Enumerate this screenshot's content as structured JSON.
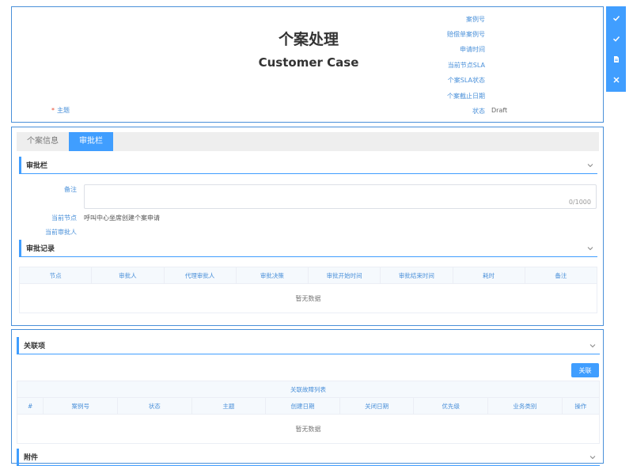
{
  "header": {
    "title_cn": "个案处理",
    "title_en": "Customer Case",
    "subject_label": "主题",
    "required_mark": "*",
    "fields": [
      {
        "label": "案例号",
        "value": ""
      },
      {
        "label": "赔偿单案例号",
        "value": ""
      },
      {
        "label": "申请时间",
        "value": ""
      },
      {
        "label": "当前节点SLA",
        "value": ""
      },
      {
        "label": "个案SLA状态",
        "value": ""
      },
      {
        "label": "个案截止日期",
        "value": ""
      },
      {
        "label": "状态",
        "value": "Draft"
      }
    ]
  },
  "sidebar": {
    "buttons": [
      {
        "name": "check-icon"
      },
      {
        "name": "check-icon"
      },
      {
        "name": "document-icon"
      },
      {
        "name": "close-icon"
      }
    ]
  },
  "tabs": [
    {
      "label": "个案信息",
      "active": false
    },
    {
      "label": "审批栏",
      "active": true
    }
  ],
  "approval": {
    "section_title": "审批栏",
    "remark_label": "备注",
    "remark_value": "",
    "remark_counter": "0/1000",
    "current_node_label": "当前节点",
    "current_node_value": "呼叫中心坐席创建个案申请",
    "current_approver_label": "当前审批人",
    "current_approver_value": ""
  },
  "approval_records": {
    "section_title": "审批记录",
    "columns": [
      "节点",
      "审批人",
      "代理审批人",
      "审批决策",
      "审批开始时间",
      "审批结束时间",
      "耗时",
      "备注"
    ],
    "empty_text": "暂无数据"
  },
  "related": {
    "section_title": "关联项",
    "link_button": "关联",
    "table_caption": "关联故障列表",
    "columns": [
      "#",
      "案例号",
      "状态",
      "主题",
      "创建日期",
      "关闭日期",
      "优先级",
      "业务类别",
      "操作"
    ],
    "empty_text": "暂无数据"
  },
  "attachments": {
    "section_title": "附件"
  },
  "colors": {
    "accent": "#409eff",
    "border": "#4a90d9",
    "label": "#4a90d9",
    "required": "#e6492d"
  }
}
